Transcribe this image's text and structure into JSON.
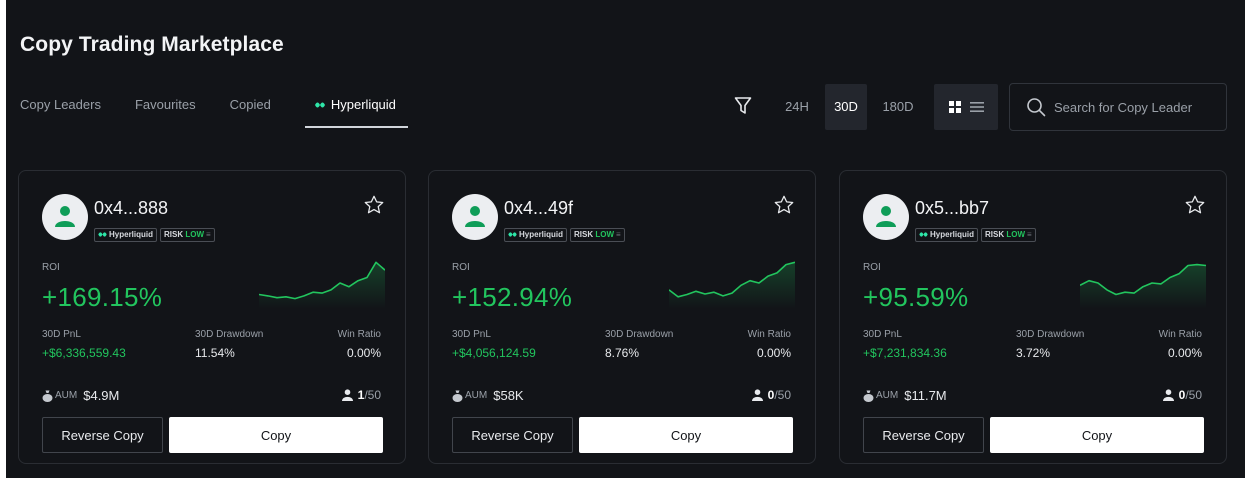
{
  "title": "Copy Trading Marketplace",
  "tabs": [
    {
      "label": "Copy Leaders"
    },
    {
      "label": "Favourites"
    },
    {
      "label": "Copied"
    },
    {
      "label": "Hyperliquid",
      "icon": "hyperliquid-logo-icon",
      "active": true
    }
  ],
  "toolbar": {
    "filter_icon": "filter-icon",
    "periods": [
      "24H",
      "30D",
      "180D"
    ],
    "active_period": "30D",
    "view_icons": [
      "grid-view-icon",
      "list-view-icon"
    ],
    "search_placeholder": "Search for Copy Leader"
  },
  "colors": {
    "background": "#121418",
    "positive": "#22c55e",
    "card_border": "#2a2d33"
  },
  "cards": [
    {
      "address": "0x4...888",
      "platform_badge": "Hyperliquid",
      "risk_label": "RISK",
      "risk_level": "LOW",
      "roi_label": "ROI",
      "roi": "+169.15%",
      "pnl_label": "30D PnL",
      "pnl": "+$6,336,559.43",
      "drawdown_label": "30D Drawdown",
      "drawdown": "11.54%",
      "winratio_label": "Win Ratio",
      "winratio": "0.00%",
      "aum_label": "AUM",
      "aum": "$4.9M",
      "copiers": "1",
      "copiers_max": "/50",
      "reverse_label": "Reverse Copy",
      "copy_label": "Copy",
      "spark": [
        0.25,
        0.22,
        0.18,
        0.2,
        0.16,
        0.22,
        0.3,
        0.28,
        0.35,
        0.5,
        0.42,
        0.55,
        0.62,
        0.95,
        0.78
      ]
    },
    {
      "address": "0x4...49f",
      "platform_badge": "Hyperliquid",
      "risk_label": "RISK",
      "risk_level": "LOW",
      "roi_label": "ROI",
      "roi": "+152.94%",
      "pnl_label": "30D PnL",
      "pnl": "+$4,056,124.59",
      "drawdown_label": "30D Drawdown",
      "drawdown": "8.76%",
      "winratio_label": "Win Ratio",
      "winratio": "0.00%",
      "aum_label": "AUM",
      "aum": "$58K",
      "copiers": "0",
      "copiers_max": "/50",
      "reverse_label": "Reverse Copy",
      "copy_label": "Copy",
      "spark": [
        0.35,
        0.2,
        0.25,
        0.32,
        0.26,
        0.3,
        0.22,
        0.28,
        0.45,
        0.55,
        0.5,
        0.65,
        0.72,
        0.9,
        0.95
      ]
    },
    {
      "address": "0x5...bb7",
      "platform_badge": "Hyperliquid",
      "risk_label": "RISK",
      "risk_level": "LOW",
      "roi_label": "ROI",
      "roi": "+95.59%",
      "pnl_label": "30D PnL",
      "pnl": "+$7,231,834.36",
      "drawdown_label": "30D Drawdown",
      "drawdown": "3.72%",
      "winratio_label": "Win Ratio",
      "winratio": "0.00%",
      "aum_label": "AUM",
      "aum": "$11.7M",
      "copiers": "0",
      "copiers_max": "/50",
      "reverse_label": "Reverse Copy",
      "copy_label": "Copy",
      "spark": [
        0.45,
        0.55,
        0.5,
        0.35,
        0.25,
        0.3,
        0.28,
        0.42,
        0.5,
        0.48,
        0.62,
        0.7,
        0.88,
        0.9,
        0.88
      ]
    }
  ]
}
